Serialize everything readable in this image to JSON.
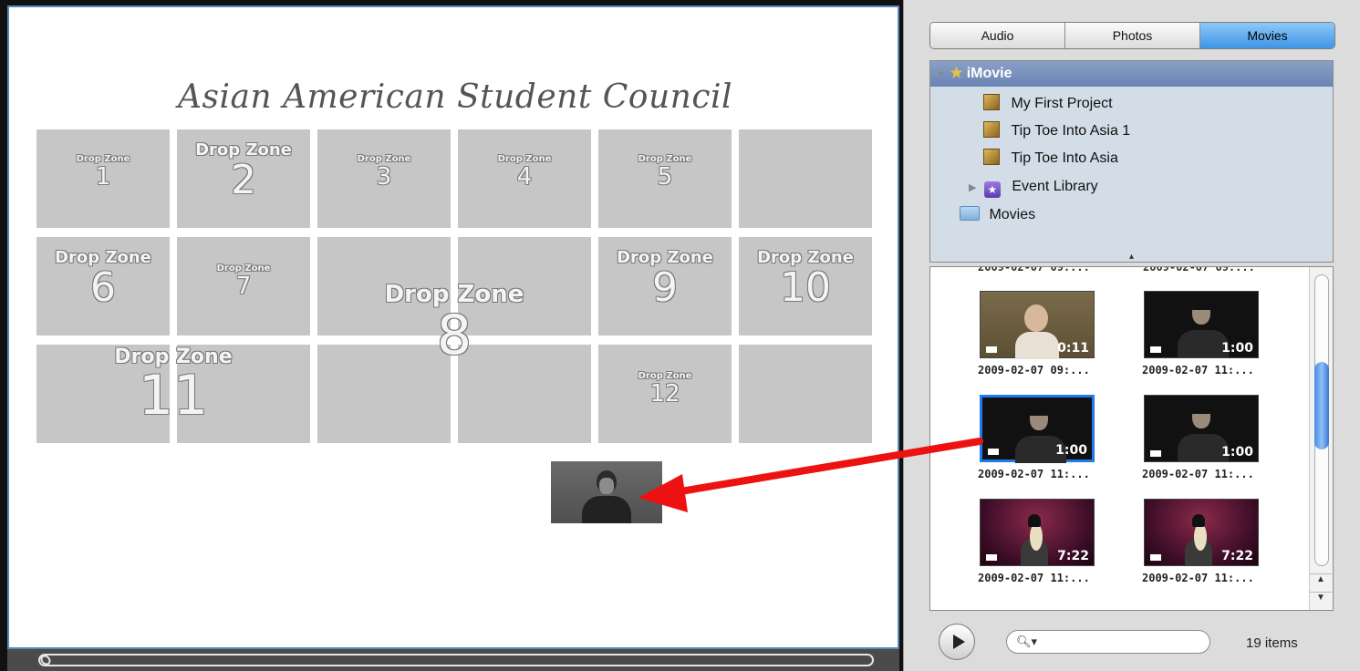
{
  "menu": {
    "title": "Asian American Student Council",
    "drop_zones": [
      {
        "label": "Drop Zone",
        "number": "1"
      },
      {
        "label": "Drop Zone",
        "number": "2"
      },
      {
        "label": "Drop Zone",
        "number": "3"
      },
      {
        "label": "Drop Zone",
        "number": "4"
      },
      {
        "label": "Drop Zone",
        "number": "5"
      },
      {
        "label": "Drop Zone",
        "number": "6"
      },
      {
        "label": "Drop Zone",
        "number": "7"
      },
      {
        "label": "Drop Zone",
        "number": "8"
      },
      {
        "label": "Drop Zone",
        "number": "9"
      },
      {
        "label": "Drop Zone",
        "number": "10"
      },
      {
        "label": "Drop Zone",
        "number": "11"
      },
      {
        "label": "Drop Zone",
        "number": "12"
      }
    ]
  },
  "browser": {
    "tabs": [
      "Audio",
      "Photos",
      "Movies"
    ],
    "selected_tab": "Movies",
    "source": {
      "root": "iMovie",
      "items": [
        "My First Project",
        "Tip Toe Into Asia 1",
        "Tip Toe Into Asia",
        "Event Library",
        "Movies"
      ]
    },
    "partial_captions": [
      "2009-02-07 09:...",
      "2009-02-07 09:..."
    ],
    "clips": [
      {
        "duration": "0:11",
        "caption": "2009-02-07 09:..."
      },
      {
        "duration": "1:00",
        "caption": "2009-02-07 11:..."
      },
      {
        "duration": "1:00",
        "caption": "2009-02-07 11:..."
      },
      {
        "duration": "1:00",
        "caption": "2009-02-07 11:..."
      },
      {
        "duration": "7:22",
        "caption": "2009-02-07 11:..."
      },
      {
        "duration": "7:22",
        "caption": "2009-02-07 11:..."
      }
    ],
    "search_placeholder": "",
    "item_count": "19 items"
  },
  "colors": {
    "selection": "#1e7af0",
    "arrow": "#ee1111",
    "drop_zone_fill": "#c6c6c6"
  }
}
